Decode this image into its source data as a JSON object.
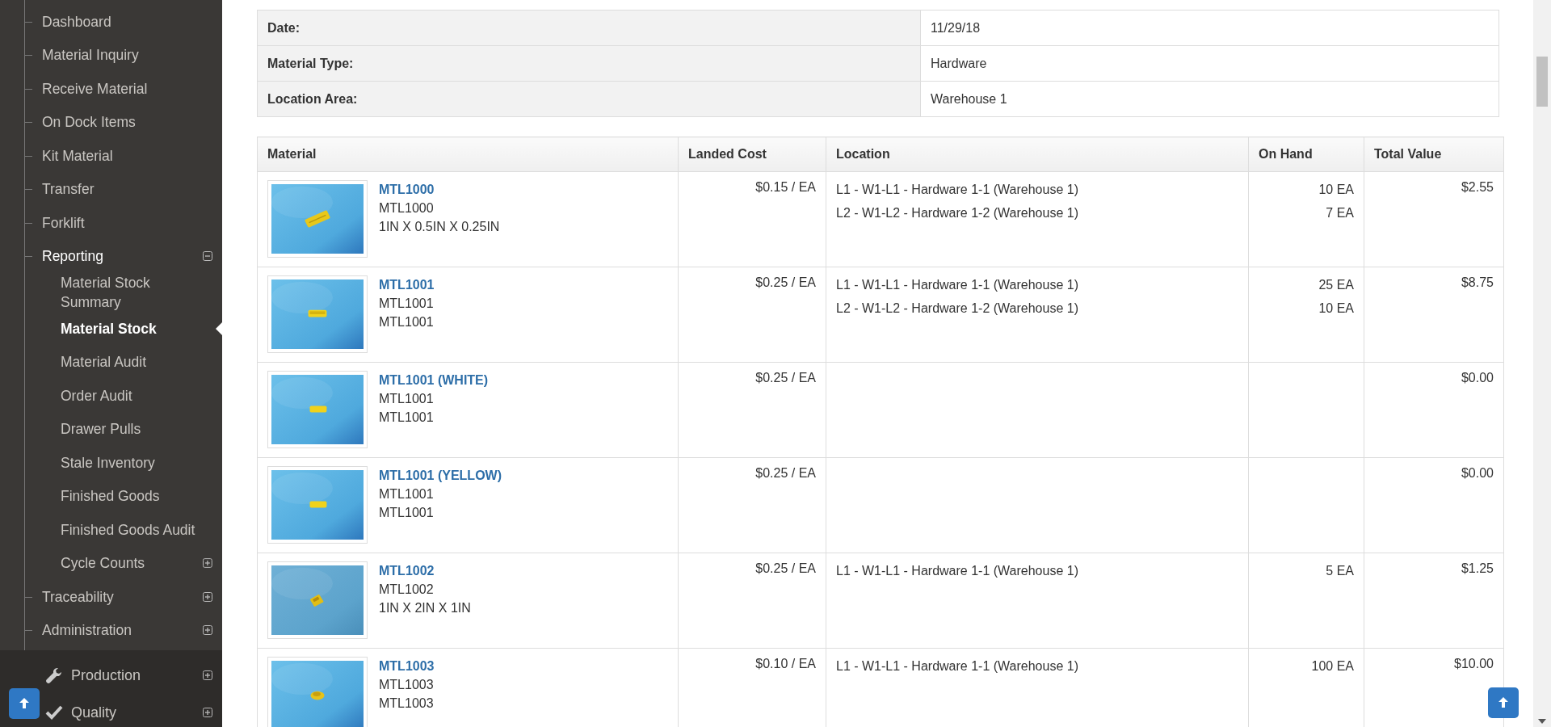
{
  "sidebar": {
    "items": [
      {
        "label": "Dashboard",
        "selected": false
      },
      {
        "label": "Material Inquiry",
        "selected": false
      },
      {
        "label": "Receive Material",
        "selected": false
      },
      {
        "label": "On Dock Items",
        "selected": false
      },
      {
        "label": "Kit Material",
        "selected": false
      },
      {
        "label": "Transfer",
        "selected": false
      },
      {
        "label": "Forklift",
        "selected": false
      },
      {
        "label": "Reporting",
        "selected": false,
        "expanded": true,
        "children": [
          {
            "label": "Material Stock Summary",
            "selected": false
          },
          {
            "label": "Material Stock",
            "selected": true
          },
          {
            "label": "Material Audit",
            "selected": false
          },
          {
            "label": "Order Audit",
            "selected": false
          },
          {
            "label": "Drawer Pulls",
            "selected": false
          },
          {
            "label": "Stale Inventory",
            "selected": false
          },
          {
            "label": "Finished Goods",
            "selected": false
          },
          {
            "label": "Finished Goods Audit",
            "selected": false
          },
          {
            "label": "Cycle Counts",
            "selected": false,
            "expanded": false
          }
        ]
      },
      {
        "label": "Traceability",
        "selected": false,
        "expanded": false
      },
      {
        "label": "Administration",
        "selected": false,
        "expanded": false
      }
    ],
    "sections": [
      {
        "label": "Production",
        "expanded": false
      },
      {
        "label": "Quality",
        "expanded": false
      }
    ]
  },
  "info": [
    {
      "label": "Date:",
      "value": "11/29/18"
    },
    {
      "label": "Material Type:",
      "value": "Hardware"
    },
    {
      "label": "Location Area:",
      "value": "Warehouse 1"
    }
  ],
  "table": {
    "columns": [
      "Material",
      "Landed Cost",
      "Location",
      "On Hand",
      "Total Value"
    ],
    "rows": [
      {
        "name": "MTL1000",
        "code": "MTL1000",
        "description": "1IN X 0.5IN X 0.25IN",
        "landed_cost": "$0.15 / EA",
        "locations": [
          "L1 - W1-L1 - Hardware 1-1 (Warehouse 1)",
          "L2 - W1-L2 - Hardware 1-2 (Warehouse 1)"
        ],
        "on_hand": [
          "10 EA",
          "7 EA"
        ],
        "total_value": "$2.55"
      },
      {
        "name": "MTL1001",
        "code": "MTL1001",
        "description": "MTL1001",
        "landed_cost": "$0.25 / EA",
        "locations": [
          "L1 - W1-L1 - Hardware 1-1 (Warehouse 1)",
          "L2 - W1-L2 - Hardware 1-2 (Warehouse 1)"
        ],
        "on_hand": [
          "25 EA",
          "10 EA"
        ],
        "total_value": "$8.75"
      },
      {
        "name": "MTL1001 (WHITE)",
        "code": "MTL1001",
        "description": "MTL1001",
        "landed_cost": "$0.25 / EA",
        "locations": [],
        "on_hand": [],
        "total_value": "$0.00"
      },
      {
        "name": "MTL1001 (YELLOW)",
        "code": "MTL1001",
        "description": "MTL1001",
        "landed_cost": "$0.25 / EA",
        "locations": [],
        "on_hand": [],
        "total_value": "$0.00"
      },
      {
        "name": "MTL1002",
        "code": "MTL1002",
        "description": "1IN X 2IN X 1IN",
        "landed_cost": "$0.25 / EA",
        "locations": [
          "L1 - W1-L1 - Hardware 1-1 (Warehouse 1)"
        ],
        "on_hand": [
          "5 EA"
        ],
        "total_value": "$1.25"
      },
      {
        "name": "MTL1003",
        "code": "MTL1003",
        "description": "MTL1003",
        "landed_cost": "$0.10 / EA",
        "locations": [
          "L1 - W1-L1 - Hardware 1-1 (Warehouse 1)"
        ],
        "on_hand": [
          "100 EA"
        ],
        "total_value": "$10.00"
      }
    ]
  }
}
